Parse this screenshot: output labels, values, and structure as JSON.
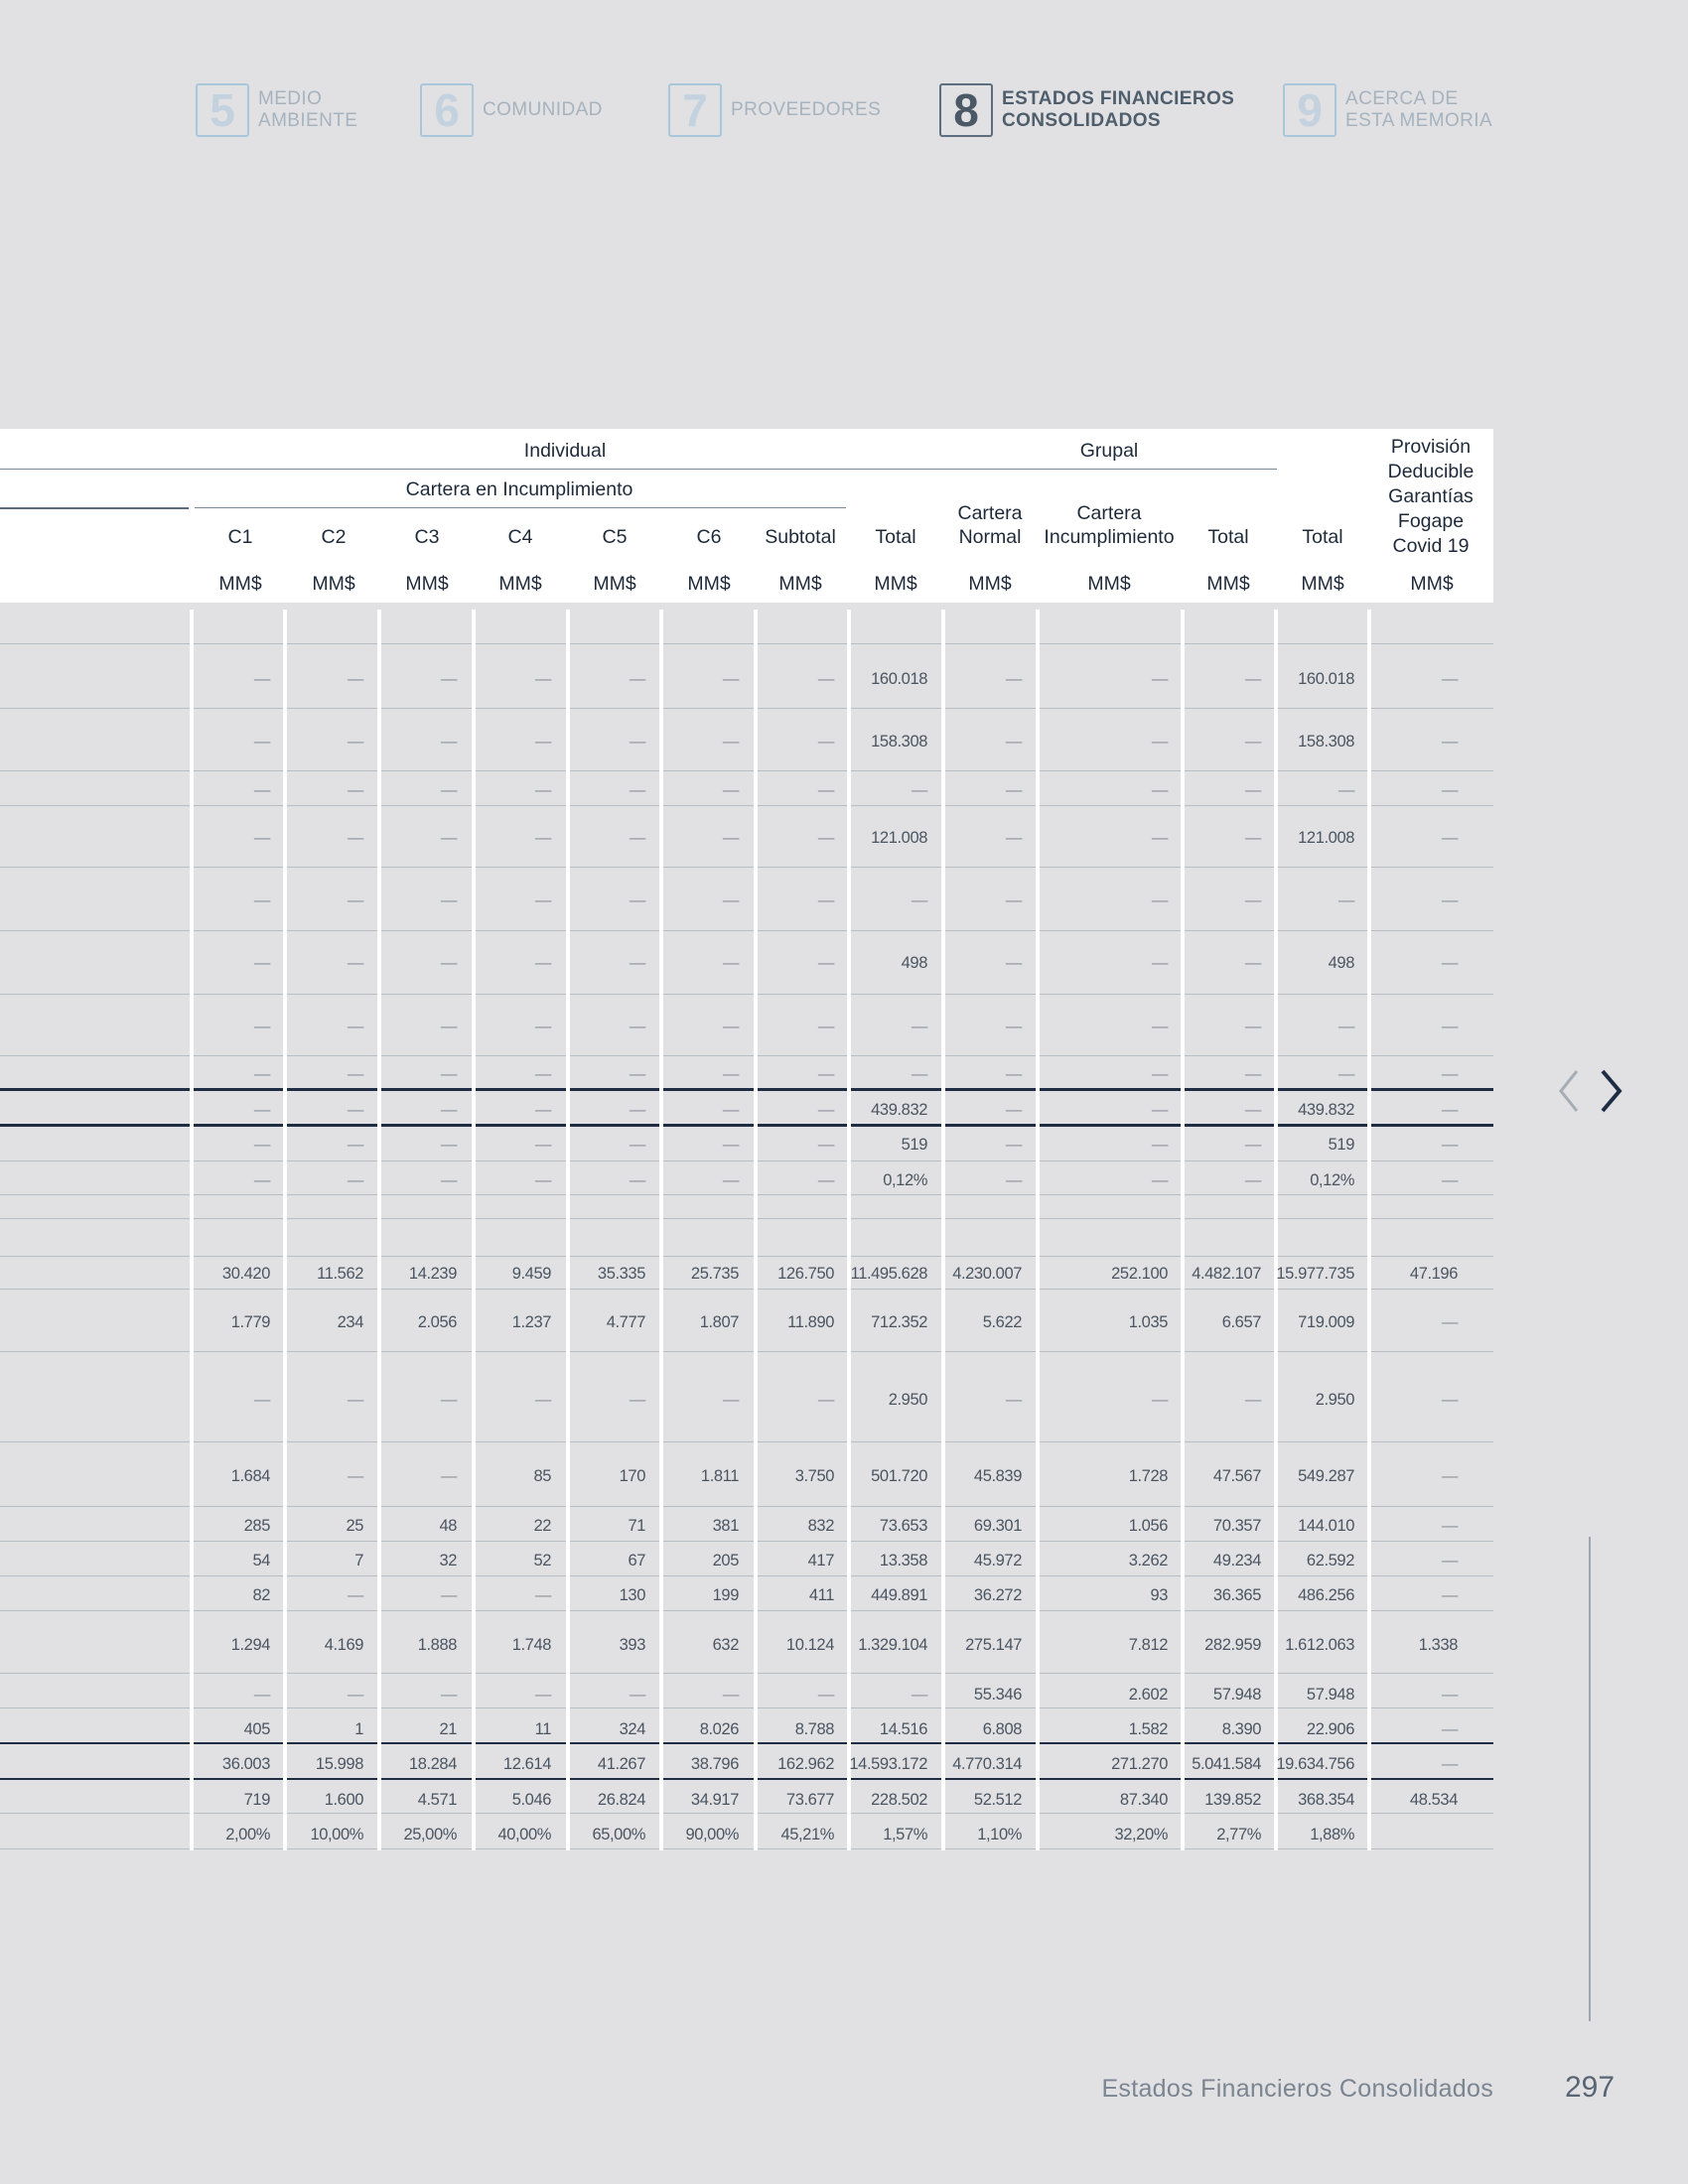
{
  "nav": {
    "items": [
      {
        "number": "5",
        "label": "MEDIO\nAMBIENTE"
      },
      {
        "number": "6",
        "label": "COMUNIDAD"
      },
      {
        "number": "7",
        "label": "PROVEEDORES"
      },
      {
        "number": "8",
        "label": "ESTADOS FINANCIEROS\nCONSOLIDADOS",
        "active": true
      },
      {
        "number": "9",
        "label": "ACERCA DE\nESTA MEMORIA"
      }
    ]
  },
  "table": {
    "headers": {
      "individual": "Individual",
      "grupal": "Grupal",
      "cartera_incumplimiento": "Cartera en Incumplimiento",
      "provision": "Provisión\nDeducible\nGarantías\nFogape\nCovid 19",
      "columns": [
        "C1",
        "C2",
        "C3",
        "C4",
        "C5",
        "C6",
        "Subtotal",
        "Total",
        "Cartera\nNormal",
        "Cartera\nIncumplimiento",
        "Total",
        "Total"
      ],
      "units": [
        "MM$",
        "MM$",
        "MM$",
        "MM$",
        "MM$",
        "MM$",
        "MM$",
        "MM$",
        "MM$",
        "MM$",
        "MM$",
        "MM$",
        "MM$"
      ]
    },
    "rows": [
      [
        "",
        "",
        "",
        "",
        "",
        "",
        "",
        "",
        "",
        "",
        "",
        "",
        ""
      ],
      [
        "—",
        "—",
        "—",
        "—",
        "—",
        "—",
        "—",
        "160.018",
        "—",
        "—",
        "—",
        "160.018",
        "—"
      ],
      [
        "—",
        "—",
        "—",
        "—",
        "—",
        "—",
        "—",
        "158.308",
        "—",
        "—",
        "—",
        "158.308",
        "—"
      ],
      [
        "—",
        "—",
        "—",
        "—",
        "—",
        "—",
        "—",
        "—",
        "—",
        "—",
        "—",
        "—",
        "—"
      ],
      [
        "—",
        "—",
        "—",
        "—",
        "—",
        "—",
        "—",
        "121.008",
        "—",
        "—",
        "—",
        "121.008",
        "—"
      ],
      [
        "—",
        "—",
        "—",
        "—",
        "—",
        "—",
        "—",
        "—",
        "—",
        "—",
        "—",
        "—",
        "—"
      ],
      [
        "—",
        "—",
        "—",
        "—",
        "—",
        "—",
        "—",
        "498",
        "—",
        "—",
        "—",
        "498",
        "—"
      ],
      [
        "—",
        "—",
        "—",
        "—",
        "—",
        "—",
        "—",
        "—",
        "—",
        "—",
        "—",
        "—",
        "—"
      ],
      [
        "—",
        "—",
        "—",
        "—",
        "—",
        "—",
        "—",
        "—",
        "—",
        "—",
        "—",
        "—",
        "—"
      ],
      [
        "—",
        "—",
        "—",
        "—",
        "—",
        "—",
        "—",
        "439.832",
        "—",
        "—",
        "—",
        "439.832",
        "—"
      ],
      [
        "—",
        "—",
        "—",
        "—",
        "—",
        "—",
        "—",
        "519",
        "—",
        "—",
        "—",
        "519",
        "—"
      ],
      [
        "—",
        "—",
        "—",
        "—",
        "—",
        "—",
        "—",
        "0,12%",
        "—",
        "—",
        "—",
        "0,12%",
        "—"
      ],
      [
        "",
        "",
        "",
        "",
        "",
        "",
        "",
        "",
        "",
        "",
        "",
        "",
        ""
      ],
      [
        "",
        "",
        "",
        "",
        "",
        "",
        "",
        "",
        "",
        "",
        "",
        "",
        ""
      ],
      [
        "30.420",
        "11.562",
        "14.239",
        "9.459",
        "35.335",
        "25.735",
        "126.750",
        "11.495.628",
        "4.230.007",
        "252.100",
        "4.482.107",
        "15.977.735",
        "47.196"
      ],
      [
        "1.779",
        "234",
        "2.056",
        "1.237",
        "4.777",
        "1.807",
        "11.890",
        "712.352",
        "5.622",
        "1.035",
        "6.657",
        "719.009",
        "—"
      ],
      [
        "—",
        "—",
        "—",
        "—",
        "—",
        "—",
        "—",
        "2.950",
        "—",
        "—",
        "—",
        "2.950",
        "—"
      ],
      [
        "1.684",
        "—",
        "—",
        "85",
        "170",
        "1.811",
        "3.750",
        "501.720",
        "45.839",
        "1.728",
        "47.567",
        "549.287",
        "—"
      ],
      [
        "285",
        "25",
        "48",
        "22",
        "71",
        "381",
        "832",
        "73.653",
        "69.301",
        "1.056",
        "70.357",
        "144.010",
        "—"
      ],
      [
        "54",
        "7",
        "32",
        "52",
        "67",
        "205",
        "417",
        "13.358",
        "45.972",
        "3.262",
        "49.234",
        "62.592",
        "—"
      ],
      [
        "82",
        "—",
        "—",
        "—",
        "130",
        "199",
        "411",
        "449.891",
        "36.272",
        "93",
        "36.365",
        "486.256",
        "—"
      ],
      [
        "1.294",
        "4.169",
        "1.888",
        "1.748",
        "393",
        "632",
        "10.124",
        "1.329.104",
        "275.147",
        "7.812",
        "282.959",
        "1.612.063",
        "1.338"
      ],
      [
        "—",
        "—",
        "—",
        "—",
        "—",
        "—",
        "—",
        "—",
        "55.346",
        "2.602",
        "57.948",
        "57.948",
        "—"
      ],
      [
        "405",
        "1",
        "21",
        "11",
        "324",
        "8.026",
        "8.788",
        "14.516",
        "6.808",
        "1.582",
        "8.390",
        "22.906",
        "—"
      ],
      [
        "36.003",
        "15.998",
        "18.284",
        "12.614",
        "41.267",
        "38.796",
        "162.962",
        "14.593.172",
        "4.770.314",
        "271.270",
        "5.041.584",
        "19.634.756",
        "—"
      ],
      [
        "719",
        "1.600",
        "4.571",
        "5.046",
        "26.824",
        "34.917",
        "73.677",
        "228.502",
        "52.512",
        "87.340",
        "139.852",
        "368.354",
        "48.534"
      ],
      [
        "2,00%",
        "10,00%",
        "25,00%",
        "40,00%",
        "65,00%",
        "90,00%",
        "45,21%",
        "1,57%",
        "1,10%",
        "32,20%",
        "2,77%",
        "1,88%",
        ""
      ]
    ]
  },
  "footer": {
    "title": "Estados Financieros Consolidados",
    "page": "297"
  }
}
